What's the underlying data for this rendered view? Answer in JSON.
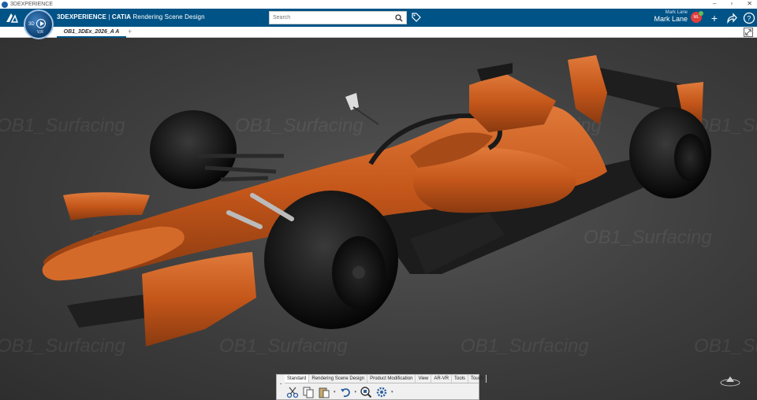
{
  "window": {
    "title": "3DEXPERIENCE",
    "controls": [
      "‒",
      "▫",
      "✕"
    ]
  },
  "header": {
    "compass_3d": "3D",
    "compass_version": "V,R",
    "brand": "3DEXPERIENCE",
    "separator": " | ",
    "product": "CATIA",
    "app": "Rendering Scene Design",
    "search_placeholder": "Search",
    "user_small": "Mark Lane",
    "user_name": "Mark Lane",
    "user_chevron": "⌄",
    "avatar_text": "ML"
  },
  "tabs": {
    "active": "OB1_3DEx_2026_A A",
    "add": "+"
  },
  "viewport": {
    "watermark": "OB1_Surfacing"
  },
  "toolbar": {
    "collapse": "⌃",
    "tabs": [
      "Standard",
      "Rendering Scene Design",
      "Product Modification",
      "View",
      "AR-VR",
      "Tools",
      "Touch"
    ]
  }
}
